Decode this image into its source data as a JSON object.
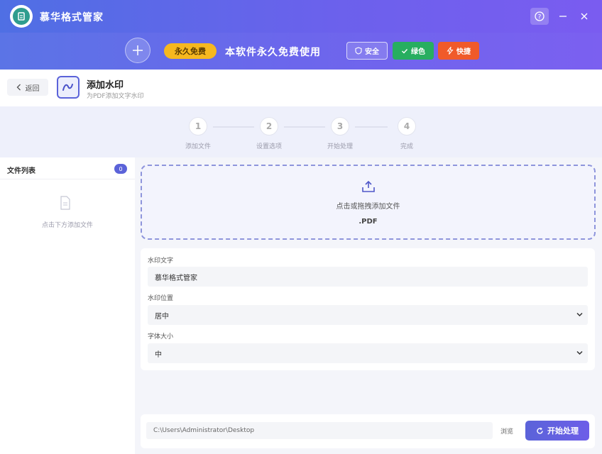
{
  "app": {
    "title": "慕华格式管家"
  },
  "banner": {
    "free_badge": "永久免费",
    "text": "本软件永久免费使用",
    "tags": [
      "安全",
      "绿色",
      "快捷"
    ]
  },
  "header": {
    "back_label": "返回",
    "title": "添加水印",
    "subtitle": "为PDF添加文字水印"
  },
  "steps": [
    {
      "num": "1",
      "label": "添加文件"
    },
    {
      "num": "2",
      "label": "设置选项"
    },
    {
      "num": "3",
      "label": "开始处理"
    },
    {
      "num": "4",
      "label": "完成"
    }
  ],
  "sidebar": {
    "title": "文件列表",
    "count": "0",
    "empty_text": "点击下方添加文件"
  },
  "upload": {
    "text": "点击或拖拽添加文件",
    "ext": ".PDF"
  },
  "settings": {
    "watermark_text_label": "水印文字",
    "watermark_text_value": "慕华格式管家",
    "position_label": "水印位置",
    "position_value": "居中",
    "font_size_label": "字体大小",
    "font_size_value": "中"
  },
  "output": {
    "path": "C:\\Users\\Administrator\\Desktop",
    "browse_label": "浏览",
    "start_label": "开始处理"
  },
  "colors": {
    "accent": "#5b63d9",
    "free_badge": "#f6b81f",
    "green_tag": "#27ae60",
    "fast_tag": "#f05a2a"
  },
  "icons": {
    "logo": "document-logo-icon",
    "help": "help-icon",
    "minimize": "minimize-icon",
    "close": "close-icon",
    "banner": "sparkle-icon",
    "safe": "shield-icon",
    "green": "check-icon",
    "fast": "lightning-icon",
    "back": "chevron-left-icon",
    "tool": "watermark-icon",
    "empty": "file-icon",
    "upload": "upload-icon",
    "dropdown": "chevron-down-icon",
    "start": "refresh-icon"
  }
}
